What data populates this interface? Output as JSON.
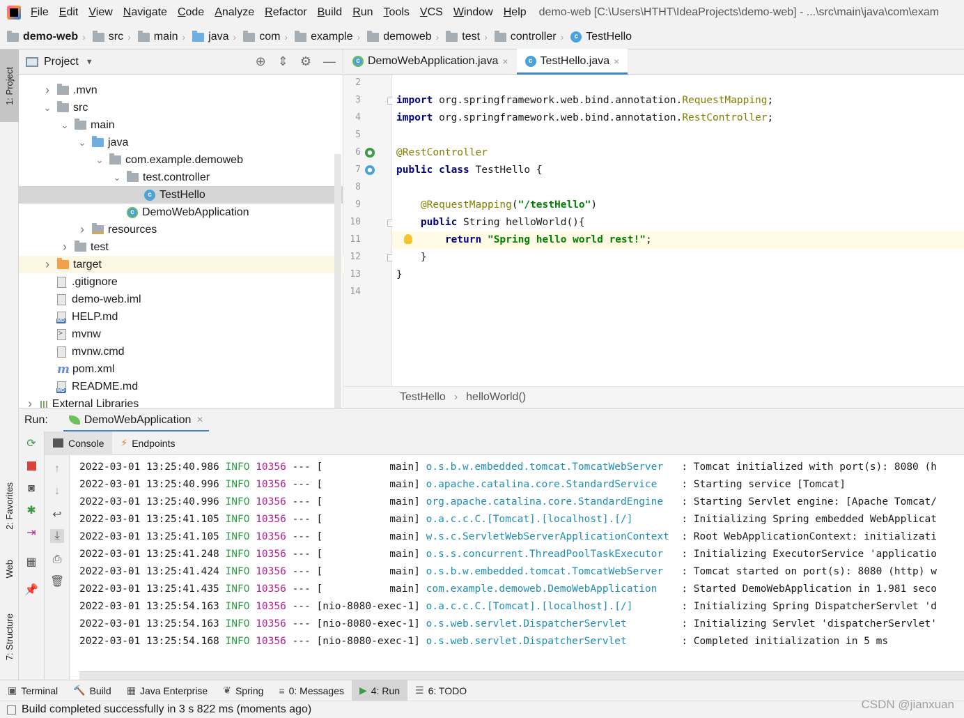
{
  "menu": [
    "File",
    "Edit",
    "View",
    "Navigate",
    "Code",
    "Analyze",
    "Refactor",
    "Build",
    "Run",
    "Tools",
    "VCS",
    "Window",
    "Help"
  ],
  "window_title": "demo-web [C:\\Users\\HTHT\\IdeaProjects\\demo-web] - ...\\src\\main\\java\\com\\exam",
  "breadcrumb": [
    "demo-web",
    "src",
    "main",
    "java",
    "com",
    "example",
    "demoweb",
    "test",
    "controller",
    "TestHello"
  ],
  "left_tabs": {
    "project": "1: Project",
    "favorites": "2: Favorites",
    "web": "Web",
    "structure": "7: Structure"
  },
  "project_panel": {
    "title": "Project",
    "tree": [
      {
        "label": ".mvn",
        "indent": 1,
        "arrow": "right",
        "icon": "folder-icon"
      },
      {
        "label": "src",
        "indent": 1,
        "arrow": "down",
        "icon": "folder-icon"
      },
      {
        "label": "main",
        "indent": 2,
        "arrow": "down",
        "icon": "folder-icon"
      },
      {
        "label": "java",
        "indent": 3,
        "arrow": "down",
        "icon": "source-folder-icon"
      },
      {
        "label": "com.example.demoweb",
        "indent": 4,
        "arrow": "down",
        "icon": "package-icon"
      },
      {
        "label": "test.controller",
        "indent": 5,
        "arrow": "down",
        "icon": "package-icon"
      },
      {
        "label": "TestHello",
        "indent": 6,
        "arrow": "",
        "icon": "class-icon",
        "selected": true
      },
      {
        "label": "DemoWebApplication",
        "indent": 5,
        "arrow": "",
        "icon": "spring-class-icon"
      },
      {
        "label": "resources",
        "indent": 3,
        "arrow": "right",
        "icon": "resources-folder-icon"
      },
      {
        "label": "test",
        "indent": 2,
        "arrow": "right",
        "icon": "folder-icon"
      },
      {
        "label": "target",
        "indent": 1,
        "arrow": "right",
        "icon": "excluded-folder-icon",
        "excluded": true
      },
      {
        "label": ".gitignore",
        "indent": 1,
        "arrow": "",
        "icon": "ignore-file-icon"
      },
      {
        "label": "demo-web.iml",
        "indent": 1,
        "arrow": "",
        "icon": "iml-file-icon"
      },
      {
        "label": "HELP.md",
        "indent": 1,
        "arrow": "",
        "icon": "markdown-file-icon"
      },
      {
        "label": "mvnw",
        "indent": 1,
        "arrow": "",
        "icon": "script-file-icon"
      },
      {
        "label": "mvnw.cmd",
        "indent": 1,
        "arrow": "",
        "icon": "text-file-icon"
      },
      {
        "label": "pom.xml",
        "indent": 1,
        "arrow": "",
        "icon": "maven-icon"
      },
      {
        "label": "README.md",
        "indent": 1,
        "arrow": "",
        "icon": "markdown-file-icon"
      },
      {
        "label": "External Libraries",
        "indent": 0,
        "arrow": "right",
        "icon": "libraries-icon"
      }
    ]
  },
  "editor": {
    "tabs": [
      {
        "label": "DemoWebApplication.java",
        "active": false
      },
      {
        "label": "TestHello.java",
        "active": true
      }
    ],
    "lines": [
      {
        "n": "2",
        "html": ""
      },
      {
        "n": "3",
        "html": "<span class=\"kw\">import</span> org.springframework.web.bind.annotation.<span class=\"an\">RequestMapping</span>;"
      },
      {
        "n": "4",
        "html": "<span class=\"kw\">import</span> org.springframework.web.bind.annotation.<span class=\"an\">RestController</span>;"
      },
      {
        "n": "5",
        "html": ""
      },
      {
        "n": "6",
        "html": "<span class=\"an\">@RestController</span>"
      },
      {
        "n": "7",
        "html": "<span class=\"kw\">public class</span> TestHello {"
      },
      {
        "n": "8",
        "html": ""
      },
      {
        "n": "9",
        "html": "    <span class=\"an\">@RequestMapping</span>(<span class=\"st\">\"/testHello\"</span>)"
      },
      {
        "n": "10",
        "html": "    <span class=\"kw\">public</span> String helloWorld(){"
      },
      {
        "n": "11",
        "html": "        <span class=\"kw\">return</span> <span class=\"st\">\"Spring hello world rest!\"</span>;",
        "highlight": true
      },
      {
        "n": "12",
        "html": "    }"
      },
      {
        "n": "13",
        "html": "}"
      },
      {
        "n": "14",
        "html": ""
      }
    ],
    "breadcrumb": [
      "TestHello",
      "helloWorld()"
    ]
  },
  "run": {
    "label": "Run:",
    "config": "DemoWebApplication",
    "console_tabs": [
      "Console",
      "Endpoints"
    ],
    "log": [
      {
        "ts": "2022-03-01 13:25:40.986",
        "level": "INFO",
        "pid": "10356",
        "sep": "---",
        "thread": "[           main]",
        "logger": "o.s.b.w.embedded.tomcat.TomcatWebServer  ",
        "msg": ": Tomcat initialized with port(s): 8080 (h"
      },
      {
        "ts": "2022-03-01 13:25:40.996",
        "level": "INFO",
        "pid": "10356",
        "sep": "---",
        "thread": "[           main]",
        "logger": "o.apache.catalina.core.StandardService   ",
        "msg": ": Starting service [Tomcat]"
      },
      {
        "ts": "2022-03-01 13:25:40.996",
        "level": "INFO",
        "pid": "10356",
        "sep": "---",
        "thread": "[           main]",
        "logger": "org.apache.catalina.core.StandardEngine  ",
        "msg": ": Starting Servlet engine: [Apache Tomcat/"
      },
      {
        "ts": "2022-03-01 13:25:41.105",
        "level": "INFO",
        "pid": "10356",
        "sep": "---",
        "thread": "[           main]",
        "logger": "o.a.c.c.C.[Tomcat].[localhost].[/]       ",
        "msg": ": Initializing Spring embedded WebApplicat"
      },
      {
        "ts": "2022-03-01 13:25:41.105",
        "level": "INFO",
        "pid": "10356",
        "sep": "---",
        "thread": "[           main]",
        "logger": "w.s.c.ServletWebServerApplicationContext ",
        "msg": ": Root WebApplicationContext: initializati"
      },
      {
        "ts": "2022-03-01 13:25:41.248",
        "level": "INFO",
        "pid": "10356",
        "sep": "---",
        "thread": "[           main]",
        "logger": "o.s.s.concurrent.ThreadPoolTaskExecutor  ",
        "msg": ": Initializing ExecutorService 'applicatio"
      },
      {
        "ts": "2022-03-01 13:25:41.424",
        "level": "INFO",
        "pid": "10356",
        "sep": "---",
        "thread": "[           main]",
        "logger": "o.s.b.w.embedded.tomcat.TomcatWebServer  ",
        "msg": ": Tomcat started on port(s): 8080 (http) w"
      },
      {
        "ts": "2022-03-01 13:25:41.435",
        "level": "INFO",
        "pid": "10356",
        "sep": "---",
        "thread": "[           main]",
        "logger": "com.example.demoweb.DemoWebApplication   ",
        "msg": ": Started DemoWebApplication in 1.981 seco"
      },
      {
        "ts": "2022-03-01 13:25:54.163",
        "level": "INFO",
        "pid": "10356",
        "sep": "---",
        "thread": "[nio-8080-exec-1]",
        "logger": "o.a.c.c.C.[Tomcat].[localhost].[/]       ",
        "msg": ": Initializing Spring DispatcherServlet 'd"
      },
      {
        "ts": "2022-03-01 13:25:54.163",
        "level": "INFO",
        "pid": "10356",
        "sep": "---",
        "thread": "[nio-8080-exec-1]",
        "logger": "o.s.web.servlet.DispatcherServlet        ",
        "msg": ": Initializing Servlet 'dispatcherServlet'"
      },
      {
        "ts": "2022-03-01 13:25:54.168",
        "level": "INFO",
        "pid": "10356",
        "sep": "---",
        "thread": "[nio-8080-exec-1]",
        "logger": "o.s.web.servlet.DispatcherServlet        ",
        "msg": ": Completed initialization in 5 ms"
      }
    ]
  },
  "bottom_tabs": [
    {
      "label": "Terminal",
      "icon": "terminal-icon"
    },
    {
      "label": "Build",
      "icon": "hammer-icon"
    },
    {
      "label": "Java Enterprise",
      "icon": "java-enterprise-icon"
    },
    {
      "label": "Spring",
      "icon": "spring-icon"
    },
    {
      "label": "0: Messages",
      "icon": "messages-icon"
    },
    {
      "label": "4: Run",
      "icon": "run-icon",
      "active": true
    },
    {
      "label": "6: TODO",
      "icon": "todo-icon"
    }
  ],
  "status": "Build completed successfully in 3 s 822 ms (moments ago)",
  "watermark": "CSDN @jianxuan",
  "colors": {
    "accent": "#4083c9",
    "info": "#2e9f44",
    "pid": "#b5208e",
    "logger": "#1d8db5",
    "keyword": "#000080",
    "annotation": "#808000",
    "string": "#008000"
  }
}
